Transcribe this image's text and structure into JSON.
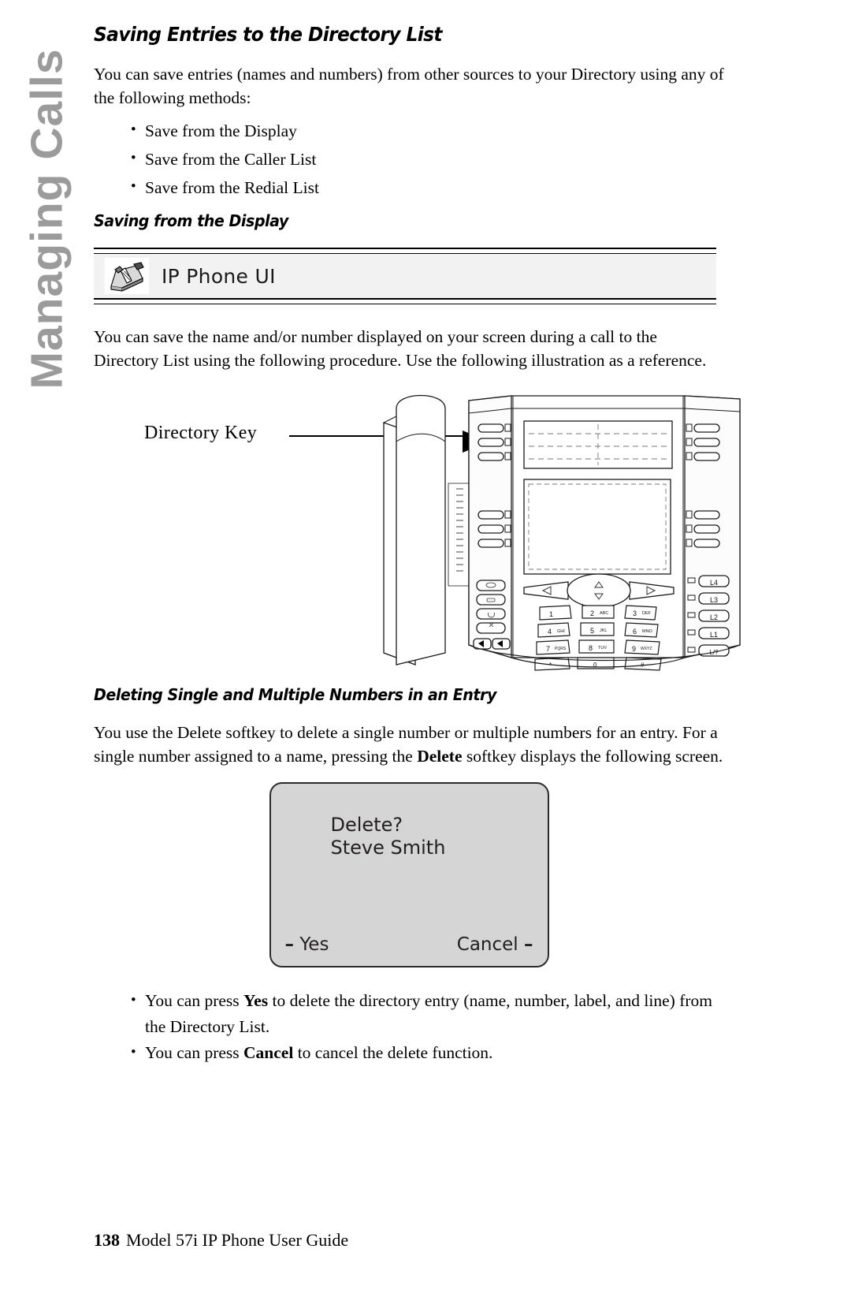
{
  "chapter_tab": {
    "label": "Managing Calls",
    "color": "#9b9b9b"
  },
  "section": {
    "title": "Saving Entries to the Directory List",
    "intro": "You can save entries (names and numbers) from other sources to your Directory using any of the following methods:",
    "methods": [
      "Save from the Display",
      "Save from the Caller List",
      "Save from the Redial List"
    ],
    "subsection_title": "Saving from the Display"
  },
  "ui_banner": {
    "icon": "ip-phone-icon",
    "label": "IP Phone UI",
    "background": "#f2f2f2"
  },
  "procedure": {
    "paragraph": "You can save the name and/or number displayed on your screen during a call to the Directory List using the following procedure. Use the following illustration as a reference."
  },
  "illustration": {
    "callout_label": "Directory Key",
    "line_keys_right": [
      "L4",
      "L3",
      "L2",
      "L1",
      "L/?"
    ],
    "keypad": [
      [
        "1",
        "2 ABC",
        "3 DEF"
      ],
      [
        "4 GHI",
        "5 JKL",
        "6 MNO"
      ],
      [
        "7 PQRS",
        "8 TUV",
        "9 WXYZ"
      ],
      [
        "*",
        "0",
        "#"
      ]
    ]
  },
  "deleting": {
    "title": "Deleting Single and Multiple Numbers in an Entry",
    "paragraph_part1": "You use the Delete softkey to delete a single number or multiple numbers for an entry. For a single number assigned to a name, pressing the ",
    "paragraph_bold": "Delete",
    "paragraph_part2": " softkey displays the following screen."
  },
  "lcd_screen": {
    "line1": "Delete?",
    "line2": "Steve Smith",
    "softkey_left_dash": "–",
    "softkey_left": "Yes",
    "softkey_right": "Cancel",
    "softkey_right_dash": "–",
    "background": "#d5d5d5"
  },
  "result_bullets": [
    {
      "part1": "You can press ",
      "bold": "Yes",
      "part2": " to delete the directory entry (name, number, label, and line) from the Directory List."
    },
    {
      "part1": "You can press ",
      "bold": "Cancel",
      "part2": " to cancel the delete function."
    }
  ],
  "footer": {
    "page_number": "138",
    "document_title": "Model 57i IP Phone User Guide"
  }
}
